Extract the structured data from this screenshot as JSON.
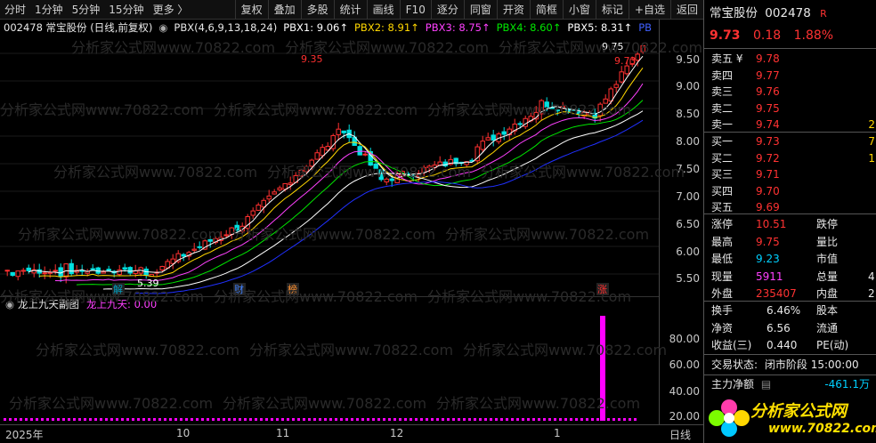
{
  "toolbar": {
    "left_items": [
      "分时",
      "1分钟",
      "5分钟",
      "15分钟",
      "更多 〉"
    ],
    "buttons": [
      "复权",
      "叠加",
      "多股",
      "统计",
      "画线",
      "F10",
      "逐分",
      "同窗",
      "开资",
      "简框",
      "小窗",
      "标记",
      "+自选",
      "返回"
    ]
  },
  "indicator": {
    "stock": "002478 常宝股份 (日线,前复权)",
    "formula": "PBX(4,6,9,13,18,24)",
    "pbx1": "PBX1: 9.06↑",
    "pbx2": "PBX2: 8.91↑",
    "pbx3": "PBX3: 8.75↑",
    "pbx4": "PBX4: 8.60↑",
    "pbx5": "PBX5: 8.31↑",
    "pbx6": "PB"
  },
  "main_chart": {
    "high_label": "9.35",
    "low_label": "5.39",
    "last_high_label": "9.75",
    "last_close_label": "9.73",
    "markers": [
      "解",
      "财",
      "榜",
      "涨"
    ],
    "price_axis": [
      "9.50",
      "9.00",
      "8.50",
      "8.00",
      "7.50",
      "7.00",
      "6.50",
      "6.00",
      "5.50"
    ]
  },
  "sub_chart": {
    "title": "龙上九天副图",
    "value_label": "龙上九天: 0.00",
    "axis": [
      "80.00",
      "60.00",
      "40.00",
      "20.00"
    ]
  },
  "date_axis": {
    "labels": [
      "2025年",
      "10",
      "11",
      "12",
      "1",
      "日线"
    ]
  },
  "panel": {
    "name": "常宝股份",
    "code": "002478",
    "flag": "R",
    "price": "9.73",
    "change": "0.18",
    "change_pct": "1.88%",
    "asks": [
      {
        "label": "卖五 ¥",
        "price": "9.78"
      },
      {
        "label": "卖四",
        "price": "9.77"
      },
      {
        "label": "卖三",
        "price": "9.76"
      },
      {
        "label": "卖二",
        "price": "9.75"
      },
      {
        "label": "卖一",
        "price": "9.74",
        "vol": "2"
      }
    ],
    "bids": [
      {
        "label": "买一",
        "price": "9.73",
        "vol": "7"
      },
      {
        "label": "买二",
        "price": "9.72",
        "vol": "1"
      },
      {
        "label": "买三",
        "price": "9.71"
      },
      {
        "label": "买四",
        "price": "9.70"
      },
      {
        "label": "买五",
        "price": "9.69"
      }
    ],
    "stats": [
      {
        "k1": "涨停",
        "v1": "10.51",
        "c1": "red",
        "k2": "跌停"
      },
      {
        "k1": "最高",
        "v1": "9.75",
        "c1": "red",
        "k2": "量比"
      },
      {
        "k1": "最低",
        "v1": "9.23",
        "c1": "cyan",
        "k2": "市值"
      },
      {
        "k1": "现量",
        "v1": "5911",
        "c1": "mag",
        "k2": "总量",
        "v2": "4"
      },
      {
        "k1": "外盘",
        "v1": "235407",
        "c1": "red",
        "k2": "内盘",
        "v2": "2"
      }
    ],
    "fund": [
      {
        "k1": "换手",
        "v1": "6.46%",
        "k2": "股本"
      },
      {
        "k1": "净资",
        "v1": "6.56",
        "k2": "流通"
      },
      {
        "k1": "收益(三)",
        "v1": "0.440",
        "k2": "PE(动)"
      }
    ],
    "trade_status_label": "交易状态:",
    "trade_status": "闭市阶段 15:00:00",
    "main_flow_label": "主力净额",
    "main_flow": "-461.1万",
    "logo_text": "分析家公式网",
    "logo_url": "www.70822.com"
  },
  "watermark": "分析家公式网www.70822.com"
}
